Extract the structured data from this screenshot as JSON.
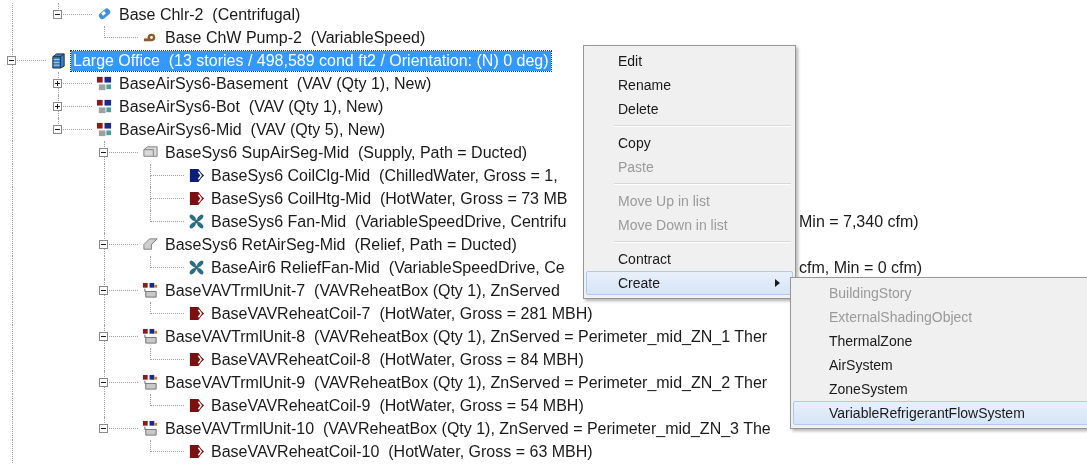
{
  "tree": {
    "continued": [
      {
        "label": "Base Chlr-2  (Centrifugal)",
        "kind": "chiller",
        "expanded": true,
        "selected": false,
        "children": [
          {
            "label": "Base ChW Pump-2  (VariableSpeed)",
            "kind": "pump",
            "selected": false
          }
        ]
      }
    ],
    "items": [
      {
        "label": "Large Office  (13 stories / 498,589 cond ft2 / Orientation: (N) 0 deg)",
        "kind": "building",
        "expanded": true,
        "selected": true,
        "children": [
          {
            "label": "BaseAirSys6-Basement  (VAV (Qty 1), New)",
            "kind": "airsys",
            "expanded": false,
            "selected": false
          },
          {
            "label": "BaseAirSys6-Bot  (VAV (Qty 1), New)",
            "kind": "airsys",
            "expanded": false,
            "selected": false
          },
          {
            "label": "BaseAirSys6-Mid  (VAV (Qty 5), New)",
            "kind": "airsys",
            "expanded": true,
            "selected": false,
            "children": [
              {
                "label": "BaseSys6 SupAirSeg-Mid  (Supply, Path = Ducted)",
                "kind": "supply-segment",
                "expanded": true,
                "selected": false,
                "children": [
                  {
                    "label": "BaseSys6 CoilClg-Mid  (ChilledWater, Gross = 1,",
                    "kind": "cooling-coil",
                    "selected": false
                  },
                  {
                    "label": "BaseSys6 CoilHtg-Mid  (HotWater, Gross = 73 MB",
                    "kind": "heating-coil",
                    "selected": false
                  },
                  {
                    "label": "BaseSys6 Fan-Mid  (VariableSpeedDrive, Centrifu",
                    "tail": "Min = 7,340 cfm)",
                    "kind": "fan",
                    "selected": false
                  }
                ]
              },
              {
                "label": "BaseSys6 RetAirSeg-Mid  (Relief, Path = Ducted)",
                "kind": "return-segment",
                "expanded": true,
                "selected": false,
                "children": [
                  {
                    "label": "BaseAir6 ReliefFan-Mid  (VariableSpeedDrive, Ce",
                    "tail": "cfm, Min = 0 cfm)",
                    "kind": "fan",
                    "selected": false
                  }
                ]
              },
              {
                "label": "BaseVAVTrmlUnit-7  (VAVReheatBox (Qty 1), ZnServed",
                "kind": "terminal",
                "expanded": true,
                "selected": false,
                "children": [
                  {
                    "label": "BaseVAVReheatCoil-7  (HotWater, Gross = 281 MBH)",
                    "kind": "heating-coil",
                    "selected": false
                  }
                ]
              },
              {
                "label": "BaseVAVTrmlUnit-8  (VAVReheatBox (Qty 1), ZnServed = Perimeter_mid_ZN_1 Ther",
                "kind": "terminal",
                "expanded": true,
                "selected": false,
                "children": [
                  {
                    "label": "BaseVAVReheatCoil-8  (HotWater, Gross = 84 MBH)",
                    "kind": "heating-coil",
                    "selected": false
                  }
                ]
              },
              {
                "label": "BaseVAVTrmlUnit-9  (VAVReheatBox (Qty 1), ZnServed = Perimeter_mid_ZN_2 Ther",
                "kind": "terminal",
                "expanded": true,
                "selected": false,
                "children": [
                  {
                    "label": "BaseVAVReheatCoil-9  (HotWater, Gross = 54 MBH)",
                    "kind": "heating-coil",
                    "selected": false
                  }
                ]
              },
              {
                "label": "BaseVAVTrmlUnit-10  (VAVReheatBox (Qty 1), ZnServed = Perimeter_mid_ZN_3 The",
                "kind": "terminal",
                "expanded": true,
                "selected": false,
                "children": [
                  {
                    "label": "BaseVAVReheatCoil-10  (HotWater, Gross = 63 MBH)",
                    "kind": "heating-coil",
                    "selected": false
                  }
                ]
              }
            ]
          }
        ]
      }
    ]
  },
  "context_menu": {
    "items": [
      {
        "kind": "item",
        "label": "Edit",
        "disabled": false
      },
      {
        "kind": "item",
        "label": "Rename",
        "disabled": false
      },
      {
        "kind": "item",
        "label": "Delete",
        "disabled": false
      },
      {
        "kind": "separator"
      },
      {
        "kind": "item",
        "label": "Copy",
        "disabled": false
      },
      {
        "kind": "item",
        "label": "Paste",
        "disabled": true
      },
      {
        "kind": "separator"
      },
      {
        "kind": "item",
        "label": "Move Up in list",
        "disabled": true
      },
      {
        "kind": "item",
        "label": "Move Down in list",
        "disabled": true
      },
      {
        "kind": "separator"
      },
      {
        "kind": "item",
        "label": "Contract",
        "disabled": false
      },
      {
        "kind": "submenu",
        "label": "Create",
        "disabled": false,
        "expanded": true
      }
    ]
  },
  "submenu": {
    "items": [
      {
        "label": "BuildingStory",
        "disabled": true,
        "selected": false
      },
      {
        "label": "ExternalShadingObject",
        "disabled": true,
        "selected": false
      },
      {
        "label": "ThermalZone",
        "disabled": false,
        "selected": false
      },
      {
        "label": "AirSystem",
        "disabled": false,
        "selected": false
      },
      {
        "label": "ZoneSystem",
        "disabled": false,
        "selected": false
      },
      {
        "label": "VariableRefrigerantFlowSystem",
        "disabled": false,
        "selected": true
      }
    ]
  }
}
